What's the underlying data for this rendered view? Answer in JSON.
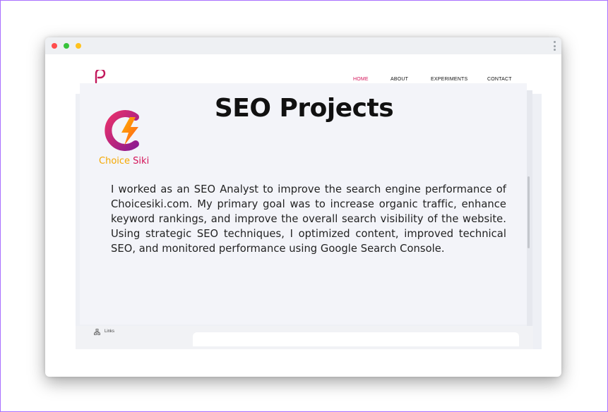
{
  "nav": {
    "home": "HOME",
    "about": "ABOUT",
    "experiments": "EXPERIMENTS",
    "contact": "CONTACT"
  },
  "page": {
    "title": "SEO Projects",
    "body": "I worked as an SEO Analyst to improve the search engine performance of Choicesiki.com. My primary goal was to increase organic traffic, enhance keyword rankings, and improve the overall search visibility of the website. Using strategic SEO techniques, I optimized content, improved technical SEO, and monitored performance using Google Search Console."
  },
  "brand": {
    "name_part1": "Choice ",
    "name_part2": "Siki"
  },
  "footer": {
    "links_label": "Links"
  },
  "colors": {
    "accent": "#d4145a",
    "brand_orange": "#f5a800"
  }
}
